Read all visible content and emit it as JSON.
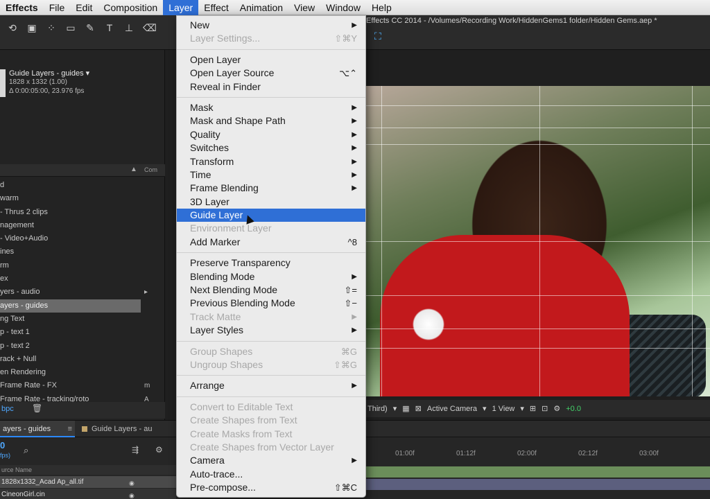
{
  "menubar": {
    "items": [
      "Effects",
      "File",
      "Edit",
      "Composition",
      "Layer",
      "Effect",
      "Animation",
      "View",
      "Window",
      "Help"
    ],
    "active_index": 4
  },
  "window": {
    "title": "Effects CC 2014 - /Volumes/Recording Work/HiddenGems1 folder/Hidden Gems.aep *"
  },
  "project": {
    "name": "Guide Layers - guides ▾",
    "dimensions": "1828 x 1332 (1.00)",
    "duration": "Δ 0:00:05:00, 23.976 fps",
    "column_header": "Com",
    "items": [
      {
        "label": "d",
        "tag": ""
      },
      {
        "label": "warm",
        "tag": ""
      },
      {
        "label": "- Thrus 2 clips",
        "tag": ""
      },
      {
        "label": "nagement",
        "tag": ""
      },
      {
        "label": "- Video+Audio",
        "tag": ""
      },
      {
        "label": "ines",
        "tag": ""
      },
      {
        "label": "rm",
        "tag": ""
      },
      {
        "label": "ex",
        "tag": ""
      },
      {
        "label": "yers - audio",
        "tag": "▸"
      },
      {
        "label": "ayers - guides",
        "tag": ""
      },
      {
        "label": "ng Text",
        "tag": ""
      },
      {
        "label": "p - text 1",
        "tag": ""
      },
      {
        "label": "p - text 2",
        "tag": ""
      },
      {
        "label": "rack + Null",
        "tag": ""
      },
      {
        "label": "en Rendering",
        "tag": ""
      },
      {
        "label": "Frame Rate - FX",
        "tag": "m"
      },
      {
        "label": "Frame Rate - tracking/roto",
        "tag": "A"
      }
    ],
    "selected_index": 9,
    "footer_bpc": "bpc"
  },
  "viewer": {
    "view_label": "Third)",
    "camera": "Active Camera",
    "views": "1 View",
    "exposure": "+0.0"
  },
  "timeline": {
    "tab_active": "ayers - guides",
    "tab_other": "Guide Layers - au",
    "time": "0",
    "fps": "fps)",
    "column_header": "urce Name",
    "layers": [
      "1828x1332_Acad Ap_all.tif",
      "CineonGirl.cin"
    ],
    "ruler_ticks": [
      "01:00f",
      "01:12f",
      "02:00f",
      "02:12f",
      "03:00f"
    ]
  },
  "layer_menu": {
    "groups": [
      [
        {
          "label": "New",
          "shortcut": "",
          "submenu": true,
          "disabled": false
        },
        {
          "label": "Layer Settings...",
          "shortcut": "⇧⌘Y",
          "submenu": false,
          "disabled": true
        }
      ],
      [
        {
          "label": "Open Layer",
          "shortcut": "",
          "submenu": false,
          "disabled": false
        },
        {
          "label": "Open Layer Source",
          "shortcut": "⌥⌃",
          "submenu": false,
          "disabled": false
        },
        {
          "label": "Reveal in Finder",
          "shortcut": "",
          "submenu": false,
          "disabled": false
        }
      ],
      [
        {
          "label": "Mask",
          "shortcut": "",
          "submenu": true,
          "disabled": false
        },
        {
          "label": "Mask and Shape Path",
          "shortcut": "",
          "submenu": true,
          "disabled": false
        },
        {
          "label": "Quality",
          "shortcut": "",
          "submenu": true,
          "disabled": false
        },
        {
          "label": "Switches",
          "shortcut": "",
          "submenu": true,
          "disabled": false
        },
        {
          "label": "Transform",
          "shortcut": "",
          "submenu": true,
          "disabled": false
        },
        {
          "label": "Time",
          "shortcut": "",
          "submenu": true,
          "disabled": false
        },
        {
          "label": "Frame Blending",
          "shortcut": "",
          "submenu": true,
          "disabled": false
        },
        {
          "label": "3D Layer",
          "shortcut": "",
          "submenu": false,
          "disabled": false
        },
        {
          "label": "Guide Layer",
          "shortcut": "",
          "submenu": false,
          "disabled": false,
          "highlighted": true
        },
        {
          "label": "Environment Layer",
          "shortcut": "",
          "submenu": false,
          "disabled": true
        },
        {
          "label": "Add Marker",
          "shortcut": "^8",
          "submenu": false,
          "disabled": false
        }
      ],
      [
        {
          "label": "Preserve Transparency",
          "shortcut": "",
          "submenu": false,
          "disabled": false
        },
        {
          "label": "Blending Mode",
          "shortcut": "",
          "submenu": true,
          "disabled": false
        },
        {
          "label": "Next Blending Mode",
          "shortcut": "⇧=",
          "submenu": false,
          "disabled": false
        },
        {
          "label": "Previous Blending Mode",
          "shortcut": "⇧−",
          "submenu": false,
          "disabled": false
        },
        {
          "label": "Track Matte",
          "shortcut": "",
          "submenu": true,
          "disabled": true
        },
        {
          "label": "Layer Styles",
          "shortcut": "",
          "submenu": true,
          "disabled": false
        }
      ],
      [
        {
          "label": "Group Shapes",
          "shortcut": "⌘G",
          "submenu": false,
          "disabled": true
        },
        {
          "label": "Ungroup Shapes",
          "shortcut": "⇧⌘G",
          "submenu": false,
          "disabled": true
        }
      ],
      [
        {
          "label": "Arrange",
          "shortcut": "",
          "submenu": true,
          "disabled": false
        }
      ],
      [
        {
          "label": "Convert to Editable Text",
          "shortcut": "",
          "submenu": false,
          "disabled": true
        },
        {
          "label": "Create Shapes from Text",
          "shortcut": "",
          "submenu": false,
          "disabled": true
        },
        {
          "label": "Create Masks from Text",
          "shortcut": "",
          "submenu": false,
          "disabled": true
        },
        {
          "label": "Create Shapes from Vector Layer",
          "shortcut": "",
          "submenu": false,
          "disabled": true
        },
        {
          "label": "Camera",
          "shortcut": "",
          "submenu": true,
          "disabled": false
        },
        {
          "label": "Auto-trace...",
          "shortcut": "",
          "submenu": false,
          "disabled": false
        },
        {
          "label": "Pre-compose...",
          "shortcut": "⇧⌘C",
          "submenu": false,
          "disabled": false
        }
      ]
    ]
  },
  "colors": {
    "accent": "#2f6fd6",
    "timecode": "#4fa8ff",
    "exposure": "#44d36a"
  }
}
